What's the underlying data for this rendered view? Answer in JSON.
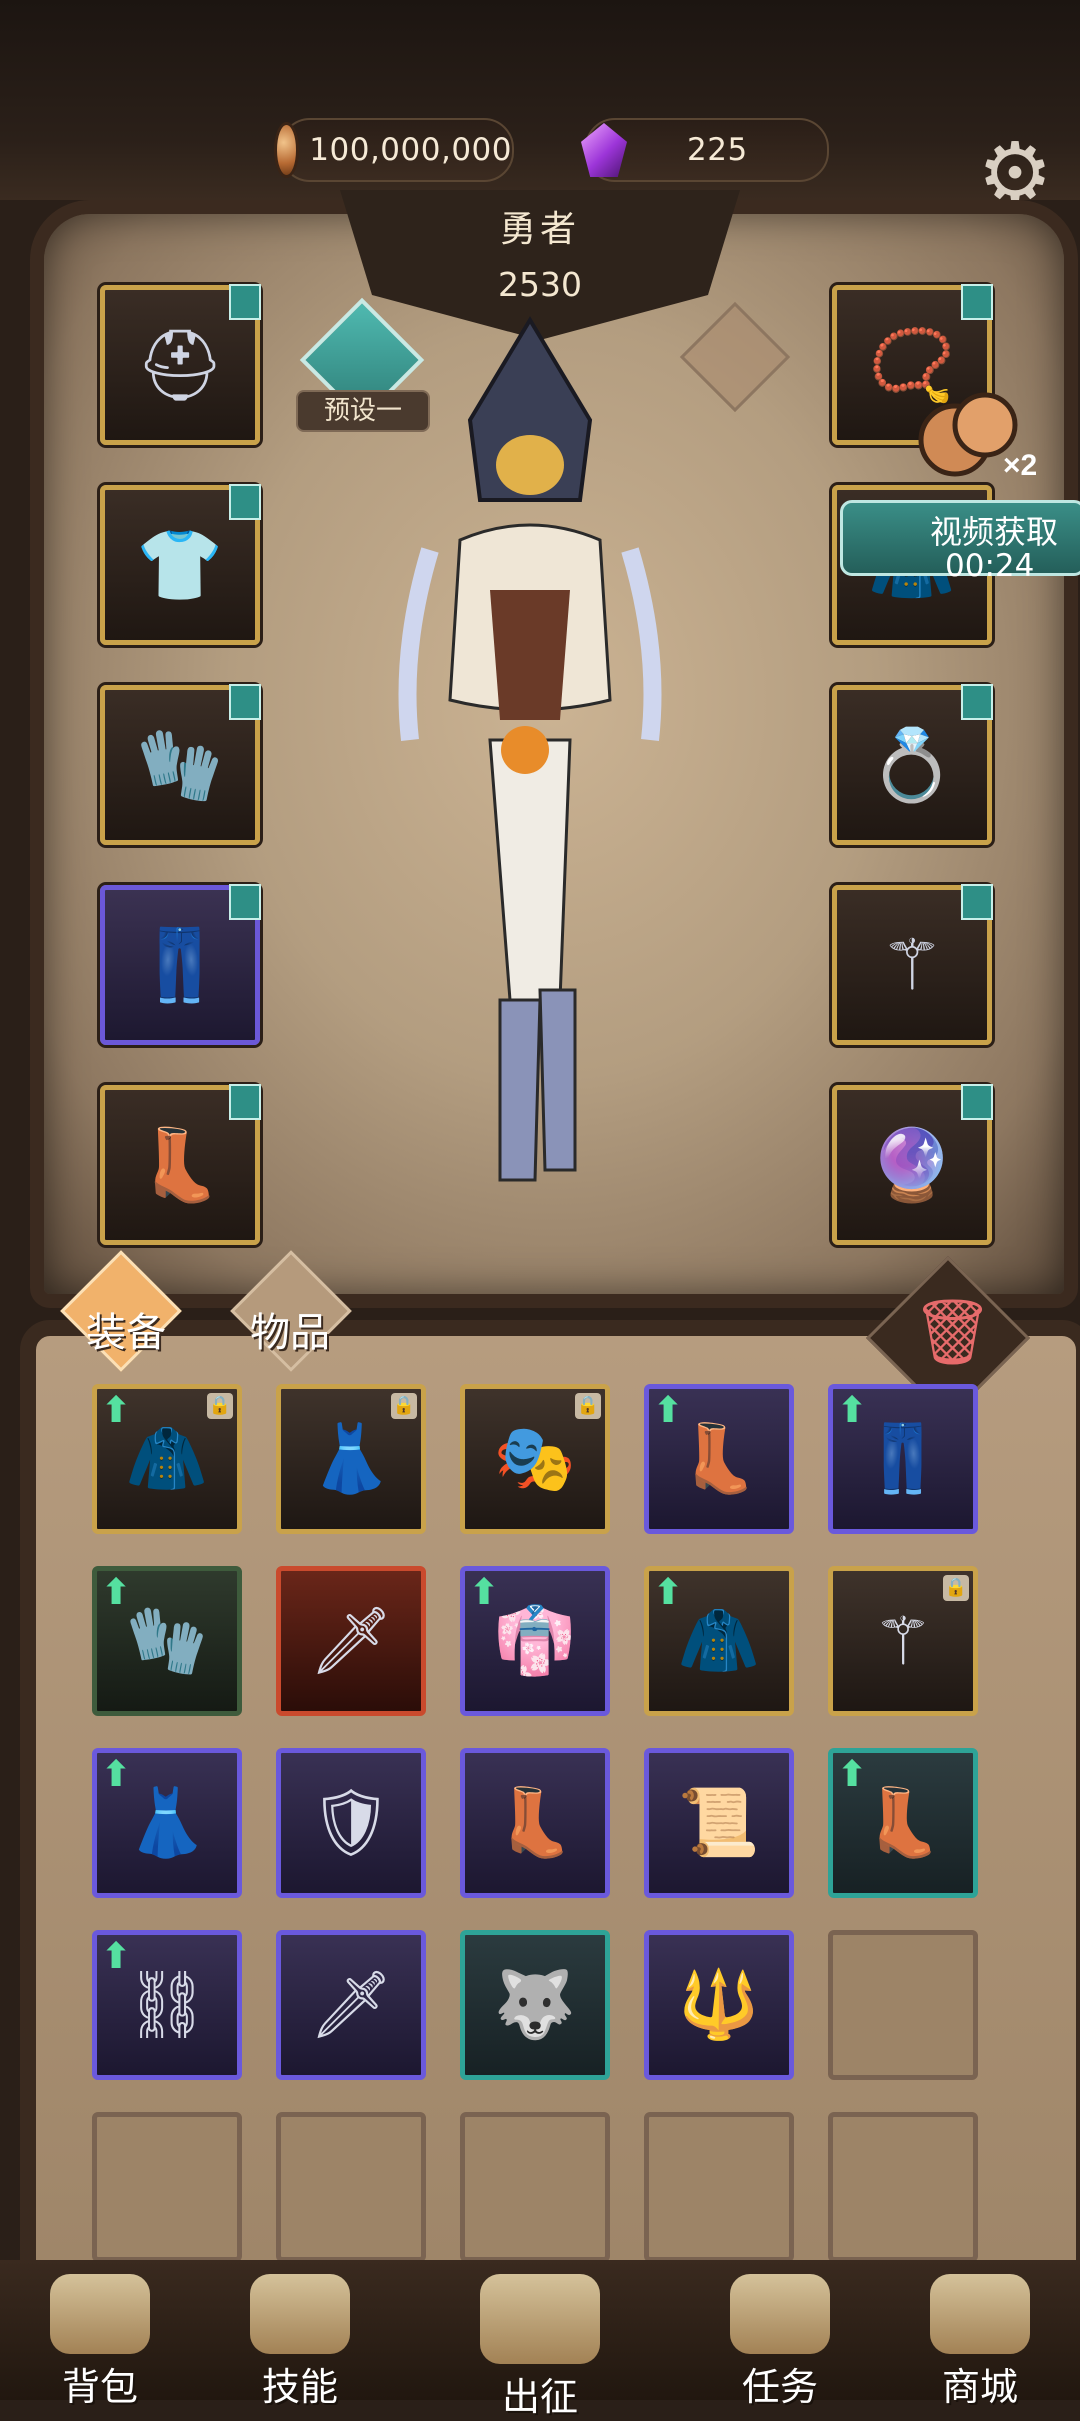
{
  "currency": {
    "coins": "100,000,000",
    "gems": "225"
  },
  "hero": {
    "title": "勇者",
    "power": "2530",
    "preset_label": "预设一"
  },
  "reward": {
    "multiplier": "×2",
    "video_label": "视频获取",
    "timer": "00:24"
  },
  "equipment_slots": {
    "left": [
      "helmet",
      "chest",
      "gloves",
      "pants",
      "boots"
    ],
    "right": [
      "amulet",
      "cloak",
      "ring",
      "staff",
      "offhand"
    ]
  },
  "inventory": {
    "tabs": [
      {
        "label": "装备",
        "active": true
      },
      {
        "label": "物品",
        "active": false
      }
    ],
    "items": [
      {
        "name": "dark-cape",
        "rarity": "gold",
        "upgrade": true,
        "locked": true
      },
      {
        "name": "flower-dress",
        "rarity": "gold",
        "upgrade": false,
        "locked": true
      },
      {
        "name": "hooded-mask",
        "rarity": "gold",
        "upgrade": false,
        "locked": true
      },
      {
        "name": "black-boots",
        "rarity": "purple",
        "upgrade": true,
        "locked": false
      },
      {
        "name": "tan-pants",
        "rarity": "purple",
        "upgrade": true,
        "locked": false
      },
      {
        "name": "leather-glove",
        "rarity": "green",
        "upgrade": true,
        "locked": false
      },
      {
        "name": "crimson-sword",
        "rarity": "red",
        "upgrade": false,
        "locked": false
      },
      {
        "name": "tattered-skirt",
        "rarity": "purple",
        "upgrade": true,
        "locked": false
      },
      {
        "name": "hooded-cape",
        "rarity": "gold",
        "upgrade": true,
        "locked": false
      },
      {
        "name": "star-staff",
        "rarity": "gold",
        "upgrade": false,
        "locked": true
      },
      {
        "name": "moon-skirt",
        "rarity": "purple",
        "upgrade": true,
        "locked": false
      },
      {
        "name": "chain-armor",
        "rarity": "purple",
        "upgrade": false,
        "locked": false
      },
      {
        "name": "white-boots",
        "rarity": "purple",
        "upgrade": false,
        "locked": false
      },
      {
        "name": "paper-charm",
        "rarity": "purple",
        "upgrade": false,
        "locked": false
      },
      {
        "name": "tall-boots",
        "rarity": "teal",
        "upgrade": true,
        "locked": false
      },
      {
        "name": "iron-bracer",
        "rarity": "purple",
        "upgrade": true,
        "locked": false
      },
      {
        "name": "thin-blade",
        "rarity": "purple",
        "upgrade": false,
        "locked": false
      },
      {
        "name": "wolf-mask",
        "rarity": "teal",
        "upgrade": false,
        "locked": false
      },
      {
        "name": "crystal-spear",
        "rarity": "purple",
        "upgrade": false,
        "locked": false
      },
      {
        "name": "empty",
        "rarity": "empty",
        "upgrade": false,
        "locked": false
      },
      {
        "name": "empty",
        "rarity": "empty",
        "upgrade": false,
        "locked": false
      },
      {
        "name": "empty",
        "rarity": "empty",
        "upgrade": false,
        "locked": false
      },
      {
        "name": "empty",
        "rarity": "empty",
        "upgrade": false,
        "locked": false
      },
      {
        "name": "empty",
        "rarity": "empty",
        "upgrade": false,
        "locked": false
      },
      {
        "name": "empty",
        "rarity": "empty",
        "upgrade": false,
        "locked": false
      }
    ]
  },
  "nav": [
    {
      "label": "背包",
      "icon": "backpack-icon"
    },
    {
      "label": "技能",
      "icon": "skill-icon"
    },
    {
      "label": "出征",
      "icon": "sword-icon"
    },
    {
      "label": "任务",
      "icon": "scroll-icon"
    },
    {
      "label": "商城",
      "icon": "shop-icon"
    }
  ]
}
